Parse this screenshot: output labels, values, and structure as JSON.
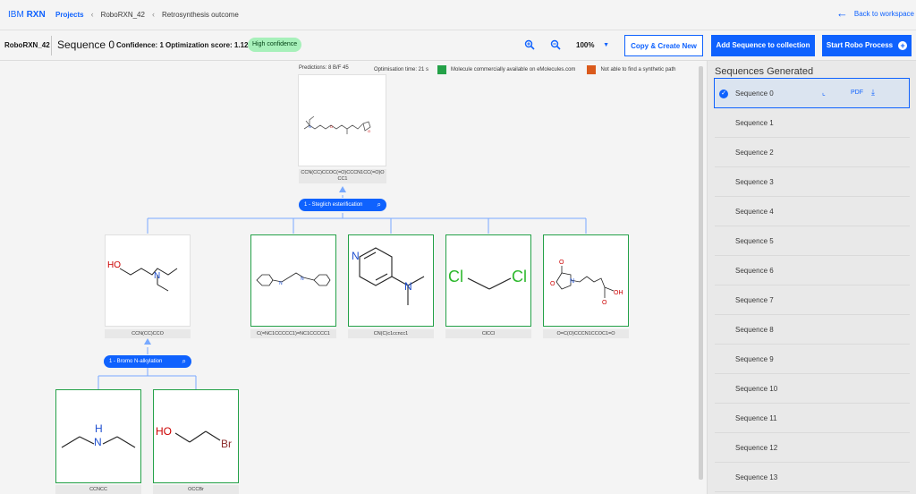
{
  "nav": {
    "brand_ibm": "IBM",
    "brand_rxn": "RXN",
    "breadcrumbs": [
      "Projects",
      "RoboRXN_42",
      "Retrosynthesis outcome"
    ],
    "back_label": "Back to workspace"
  },
  "toolbar": {
    "project": "RoboRXN_42",
    "sequence": "Sequence 0",
    "confidence": "Confidence: 1",
    "optimization": "Optimization score: 1.12",
    "badge": "High confidence",
    "zoom_in_icon": "zoom-in-icon",
    "zoom_out_icon": "zoom-out-icon",
    "zoom_value": "100%",
    "copy_btn": "Copy & Create New",
    "add_btn": "Add Sequence to collection",
    "start_btn": "Start Robo Process"
  },
  "legend": {
    "predictions": "Predictions: 8 B/F 45",
    "opt_time": "Optimisation time: 21 s",
    "available": "Molecule commercially available on eMolecules.com",
    "not_found": "Not able to find a synthetic path",
    "colors": {
      "available": "#24a148",
      "not_found": "#da5a1c"
    }
  },
  "tree": {
    "target_smiles": [
      "CCN(CC)CCOC(=O)CCCN1CC(=O)O",
      "CC1"
    ],
    "reaction1": "1 - Steglich esterification",
    "reaction2": "1 - Bromo N-alkylation",
    "mol_aminoethanol": "CCN(CC)CCO",
    "mol_dcc": "C(=NC1CCCCC1)=NC1CCCCC1",
    "mol_dmap": "CN(C)c1ccncc1",
    "mol_dcm": "ClCCl",
    "mol_acid": "O=C(O)CCCN1CCOC1=O",
    "mol_diethylamine": "CCNCC",
    "mol_bromoethanol": "OCCBr"
  },
  "panel": {
    "title": "Sequences Generated",
    "active_pdf": "PDF",
    "items": [
      "Sequence 0",
      "Sequence 1",
      "Sequence 2",
      "Sequence 3",
      "Sequence 4",
      "Sequence 5",
      "Sequence 6",
      "Sequence 7",
      "Sequence 8",
      "Sequence 9",
      "Sequence 10",
      "Sequence 11",
      "Sequence 12",
      "Sequence 13"
    ]
  }
}
